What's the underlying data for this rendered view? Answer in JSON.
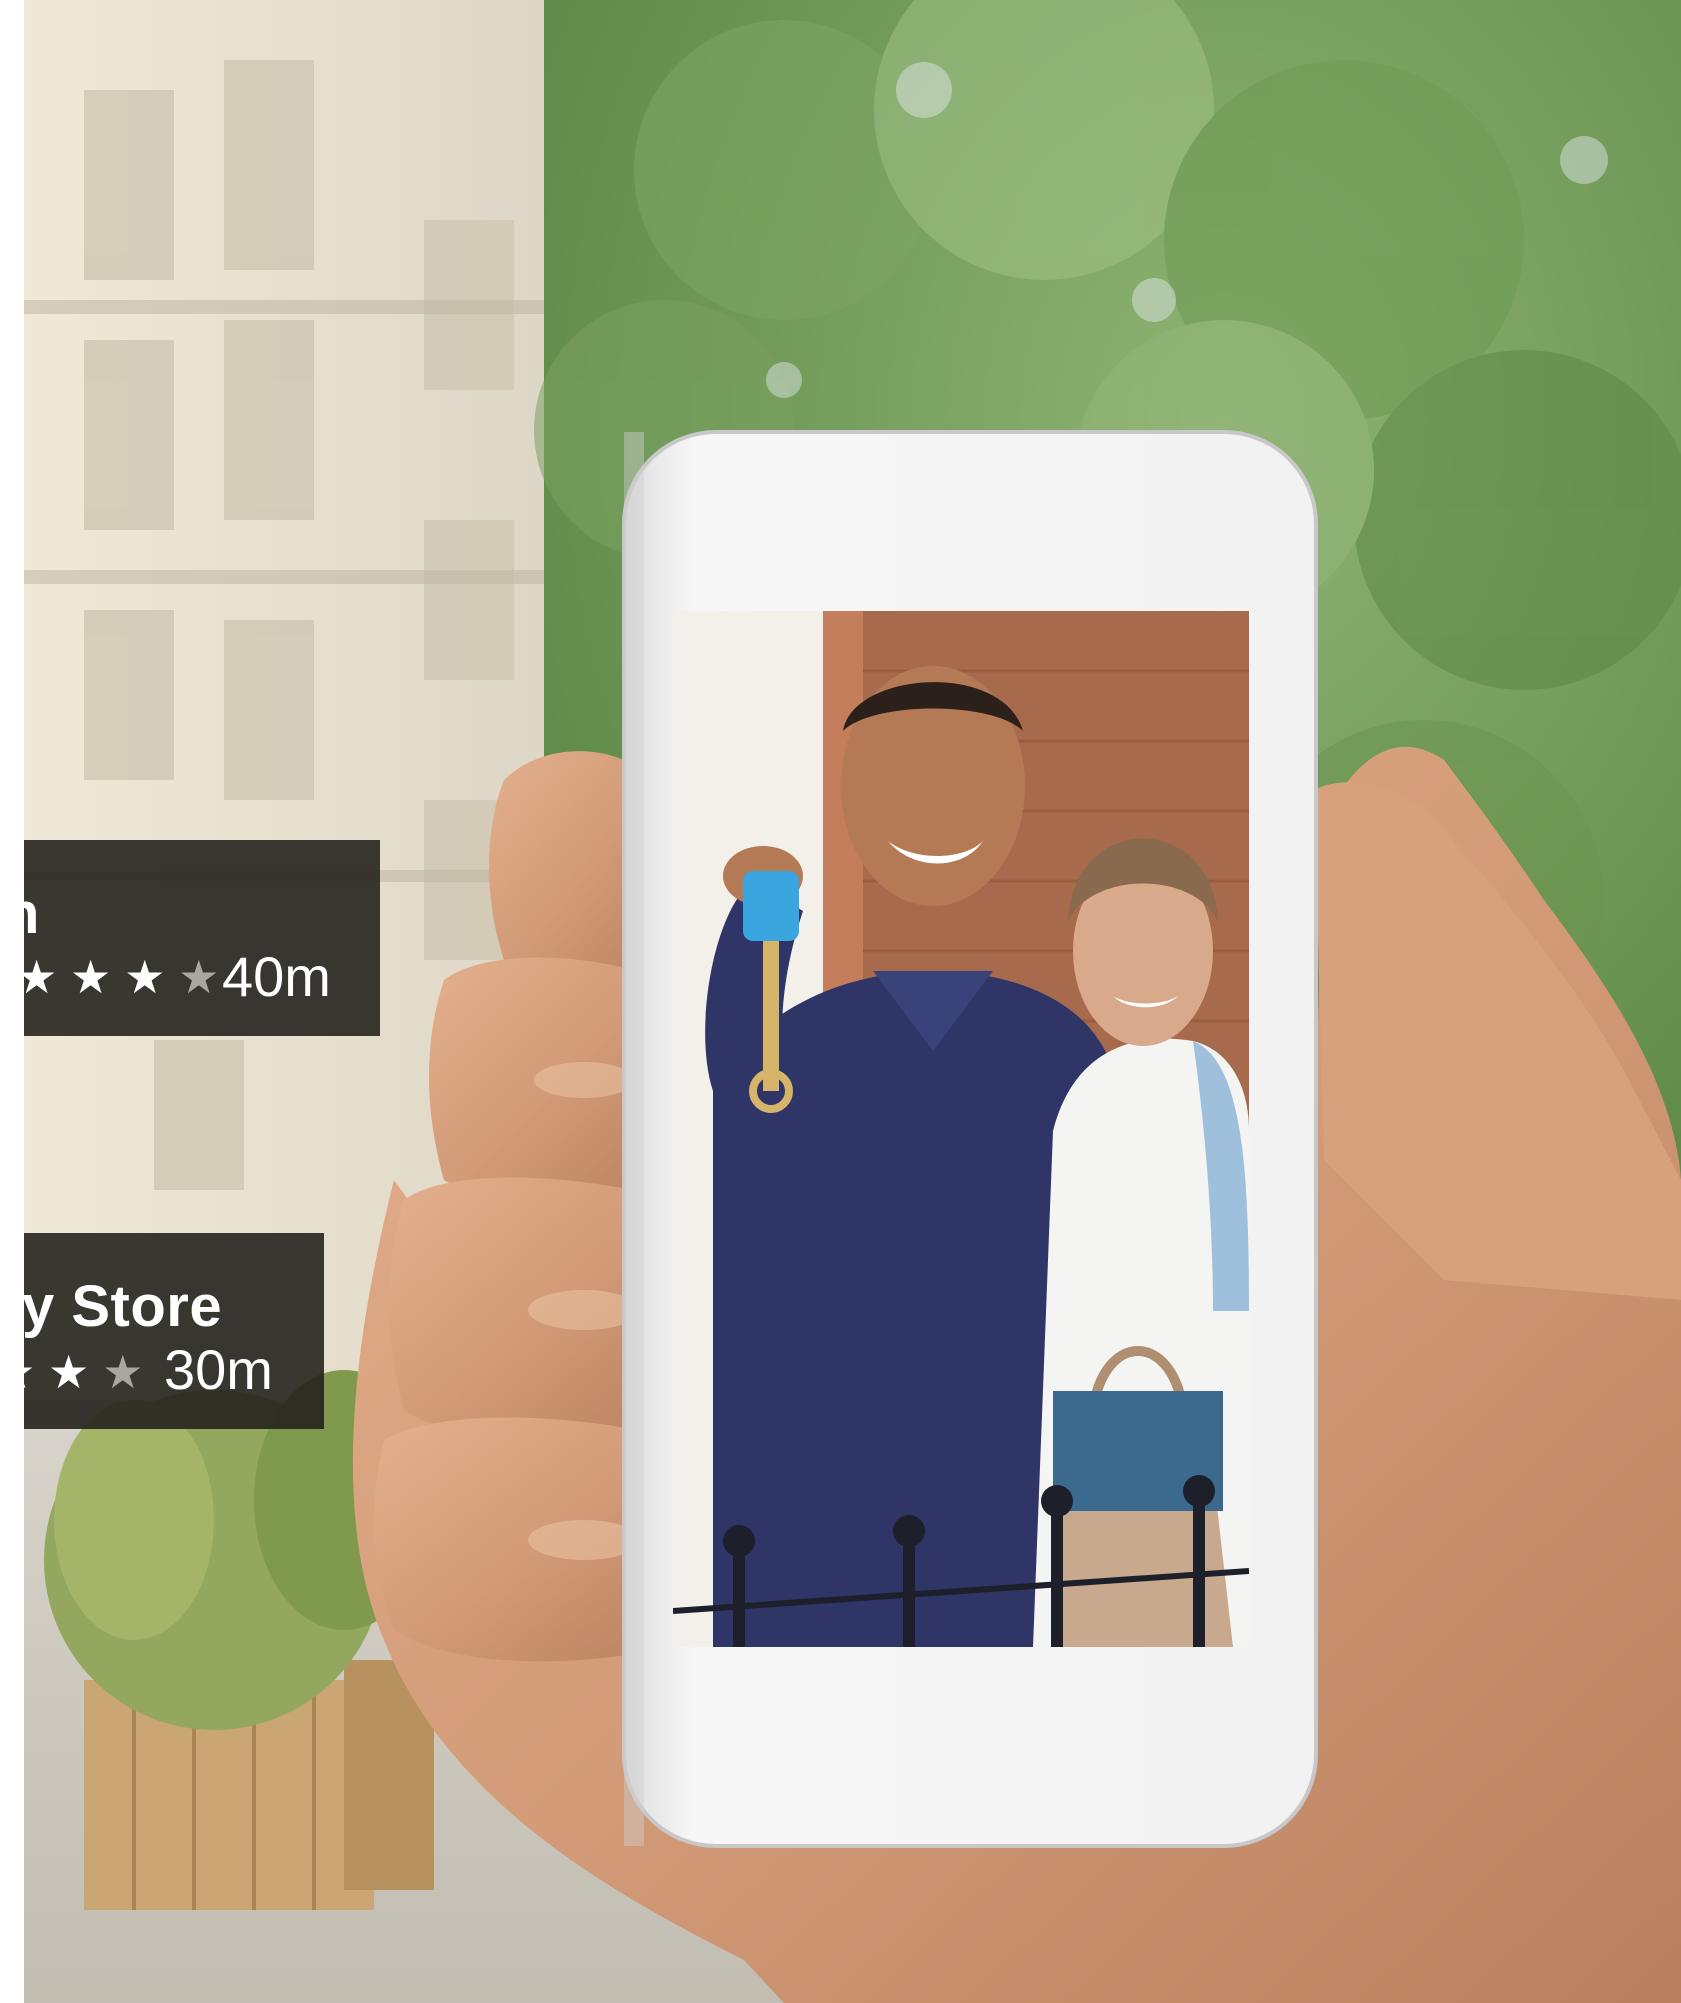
{
  "ar_overlays": [
    {
      "name": "n",
      "rating_filled": 3,
      "rating_total": 4,
      "distance": "40m"
    },
    {
      "name": "y Store",
      "rating_filled": 2,
      "rating_total": 3,
      "distance": "30m"
    }
  ],
  "colors": {
    "card_background": "#26221e",
    "card_text": "#ffffff",
    "key_fob_blue": "#3aa6df",
    "polo_shirt": "#2f3566",
    "foliage": "#6f9a55",
    "building": "#e9e0cd"
  }
}
